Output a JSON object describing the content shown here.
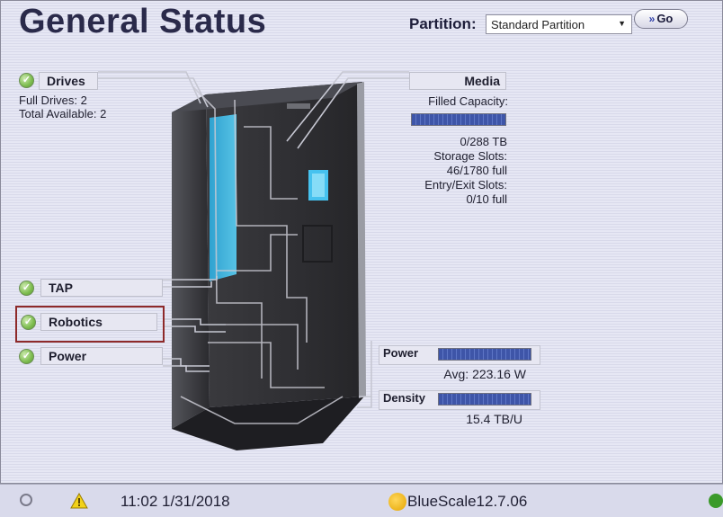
{
  "header": {
    "title": "General Status",
    "partition_label": "Partition:",
    "partition_value": "Standard Partition",
    "go_label": "Go",
    "go_chevron": "»"
  },
  "drives": {
    "label": "Drives",
    "full": "Full Drives: 2",
    "available": "Total Available: 2"
  },
  "media": {
    "label": "Media",
    "filled_capacity_label": "Filled Capacity:",
    "filled_capacity_fraction": 0.0,
    "capacity_value": "0/288 TB",
    "storage_slots_label": "Storage Slots:",
    "storage_slots_value": "46/1780 full",
    "entry_exit_label": "Entry/Exit Slots:",
    "entry_exit_value": "0/10 full"
  },
  "components": {
    "tap": "TAP",
    "robotics": "Robotics",
    "power": "Power"
  },
  "metrics": {
    "power_label": "Power",
    "power_avg": "Avg: 223.16 W",
    "density_label": "Density",
    "density_value": "15.4 TB/U"
  },
  "statusbar": {
    "time_date": "11:02 1/31/2018",
    "version": "BlueScale12.7.06"
  },
  "colors": {
    "status_ok": "#7cbc4e",
    "highlight": "#8e2a2a",
    "bar": "#3e55a8"
  },
  "icons": [
    "check-icon",
    "warning-icon",
    "refresh-icon",
    "bluescale-logo-icon",
    "network-icon",
    "dropdown-caret-icon"
  ]
}
